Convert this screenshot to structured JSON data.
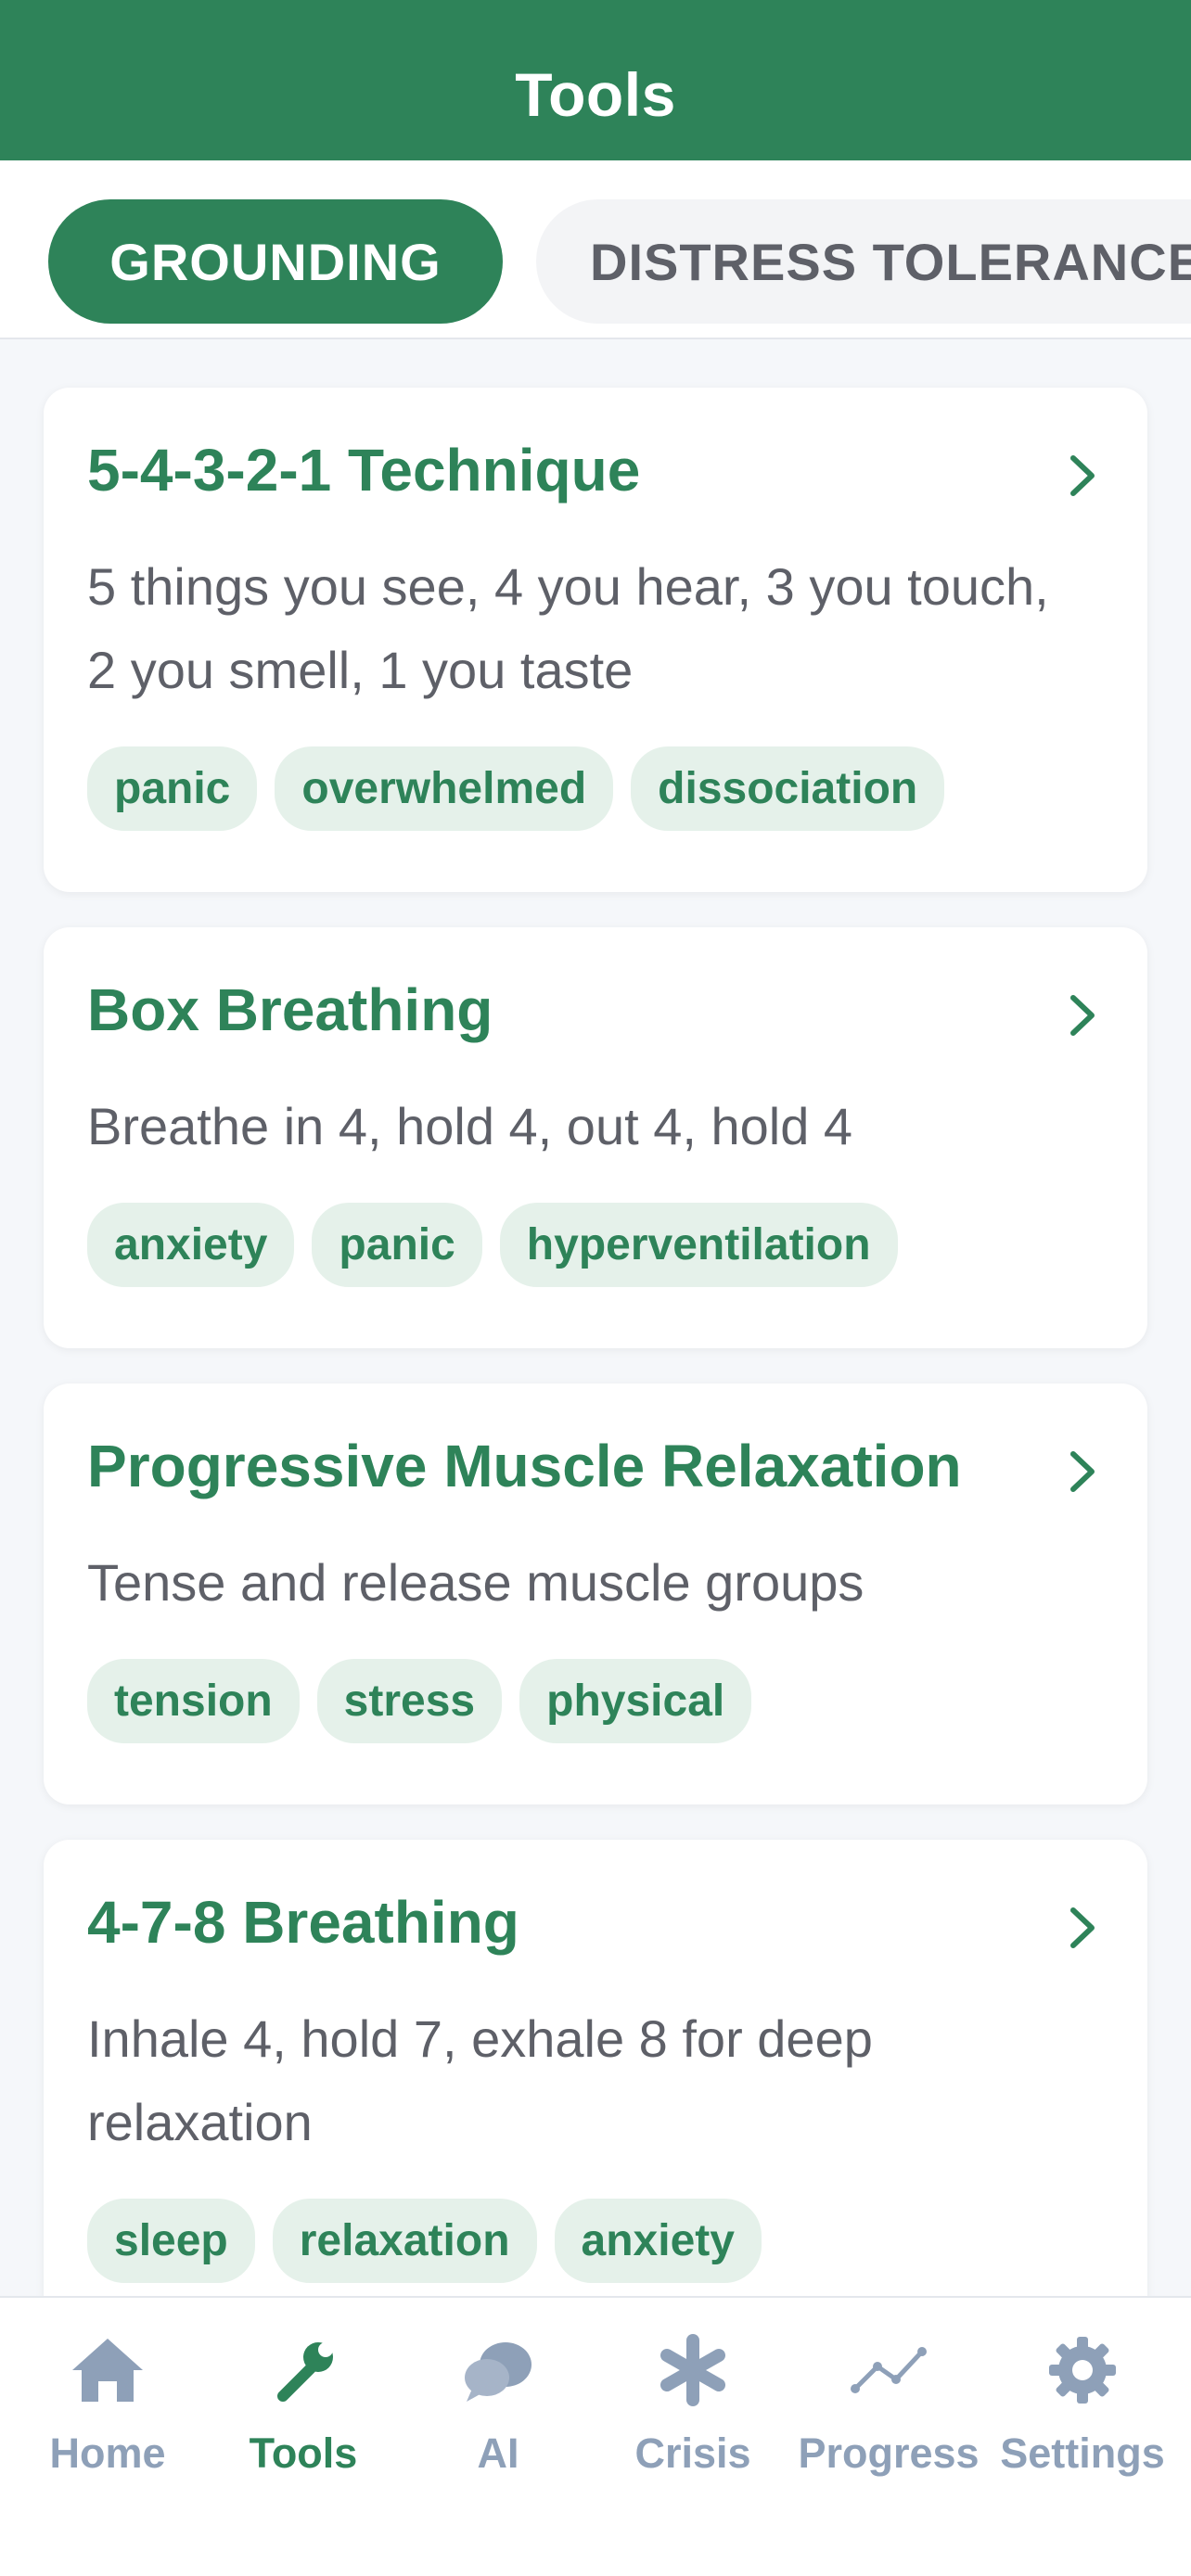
{
  "header": {
    "title": "Tools"
  },
  "tabs": [
    {
      "label": "GROUNDING",
      "active": true
    },
    {
      "label": "DISTRESS TOLERANCE",
      "active": false
    }
  ],
  "cards": [
    {
      "title": "5-4-3-2-1 Technique",
      "description": "5 things you see, 4 you hear, 3 you touch, 2 you smell, 1 you taste",
      "tags": [
        "panic",
        "overwhelmed",
        "dissociation"
      ]
    },
    {
      "title": "Box Breathing",
      "description": "Breathe in 4, hold 4, out 4, hold 4",
      "tags": [
        "anxiety",
        "panic",
        "hyperventilation"
      ]
    },
    {
      "title": "Progressive Muscle Relaxation",
      "description": "Tense and release muscle groups",
      "tags": [
        "tension",
        "stress",
        "physical"
      ]
    },
    {
      "title": "4-7-8 Breathing",
      "description": "Inhale 4, hold 7, exhale 8 for deep relaxation",
      "tags": [
        "sleep",
        "relaxation",
        "anxiety"
      ]
    }
  ],
  "nav": {
    "items": [
      {
        "label": "Home",
        "icon": "home-icon"
      },
      {
        "label": "Tools",
        "icon": "wrench-icon",
        "active": true
      },
      {
        "label": "AI",
        "icon": "chat-bubbles-icon"
      },
      {
        "label": "Crisis",
        "icon": "asterisk-icon"
      },
      {
        "label": "Progress",
        "icon": "trend-line-icon"
      },
      {
        "label": "Settings",
        "icon": "gear-icon"
      }
    ]
  },
  "colors": {
    "brand_green": "#2e8359",
    "tag_bg": "#e5f1ea",
    "inactive_nav": "#8ea0b8",
    "body_text": "#5e6068"
  }
}
